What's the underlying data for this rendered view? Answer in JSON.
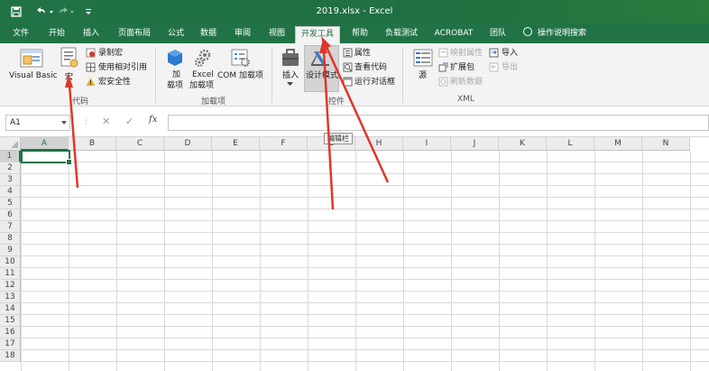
{
  "window": {
    "title": "2019.xlsx  -  Excel"
  },
  "quick_access": {
    "save_icon": "save-icon",
    "undo_icon": "undo-icon",
    "redo_icon": "redo-icon",
    "customize_icon": "customize-icon"
  },
  "tabs": [
    {
      "label": "文件"
    },
    {
      "label": "开始"
    },
    {
      "label": "插入"
    },
    {
      "label": "页面布局"
    },
    {
      "label": "公式"
    },
    {
      "label": "数据"
    },
    {
      "label": "审阅"
    },
    {
      "label": "视图"
    },
    {
      "label": "开发工具",
      "active": true
    },
    {
      "label": "帮助"
    },
    {
      "label": "负载测试"
    },
    {
      "label": "ACROBAT"
    },
    {
      "label": "团队"
    }
  ],
  "tell_me": "操作说明搜索",
  "ribbon": {
    "code": {
      "group_label": "代码",
      "visual_basic": "Visual Basic",
      "macros": "宏",
      "record_macro": "录制宏",
      "relative_refs": "使用相对引用",
      "macro_security": "宏安全性"
    },
    "addins": {
      "group_label": "加载项",
      "addins_line1": "加",
      "addins_line2": "载项",
      "excel_addins_line1": "Excel",
      "excel_addins_line2": "加载项",
      "com_addins": "COM 加载项"
    },
    "controls": {
      "group_label": "控件",
      "insert": "插入",
      "design_mode": "设计模式",
      "properties": "属性",
      "view_code": "查看代码",
      "run_dialog": "运行对话框"
    },
    "xml": {
      "group_label": "XML",
      "source": "源",
      "map_properties": "映射属性",
      "expansion_packs": "扩展包",
      "refresh_data": "刷新数据",
      "import": "导入",
      "export": "导出"
    }
  },
  "formula_bar": {
    "name_box": "A1",
    "cancel": "✕",
    "enter": "✓",
    "fx": "fx",
    "value": ""
  },
  "sheet": {
    "columns": [
      "A",
      "B",
      "C",
      "D",
      "E",
      "F",
      "G",
      "H",
      "I",
      "J",
      "K",
      "L",
      "M",
      "N"
    ],
    "rows": [
      "1",
      "2",
      "3",
      "4",
      "5",
      "6",
      "7",
      "8",
      "9",
      "10",
      "11",
      "12",
      "13",
      "14",
      "15",
      "16",
      "17",
      "18"
    ],
    "active_cell": "A1"
  },
  "tooltip": "编辑栏",
  "colors": {
    "excel_green": "#217346",
    "annotation_red": "#e0362c"
  }
}
